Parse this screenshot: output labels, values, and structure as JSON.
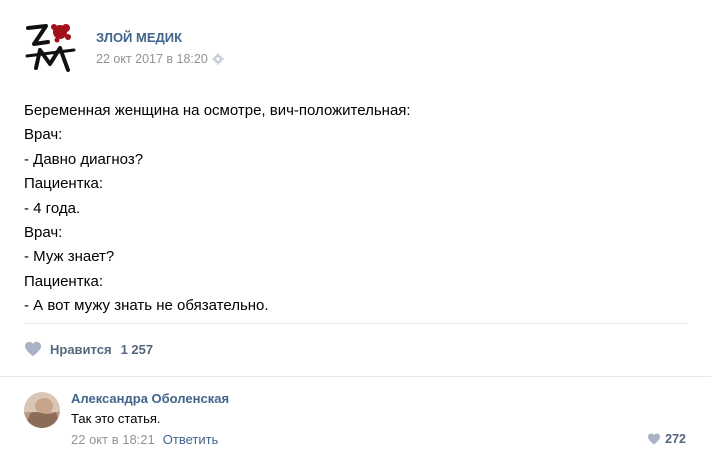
{
  "post": {
    "author": "ЗЛОЙ МЕДИК",
    "date": "22 окт 2017 в 18:20",
    "logo_text": "ЗМ",
    "lines": [
      "Беременная женщина на осмотре, вич-положительная:",
      "Врач:",
      "- Давно диагноз?",
      "Пациентка:",
      "- 4 года.",
      "Врач:",
      "- Муж знает?",
      "Пациентка:",
      "- А вот мужу знать не обязательно."
    ],
    "likes_label": "Нравится",
    "likes_count": "1 257"
  },
  "comment": {
    "author": "Александра Оболенская",
    "text": "Так это статья.",
    "date": "22 окт в 18:21",
    "reply_label": "Ответить",
    "likes_count": "272"
  },
  "icons": {
    "settings": "gear-icon",
    "like": "heart-icon",
    "comment_like": "heart-icon"
  },
  "colors": {
    "link": "#42648b",
    "muted": "#939393",
    "like_icon": "#a8b4c4",
    "logo_red": "#a3101a"
  }
}
